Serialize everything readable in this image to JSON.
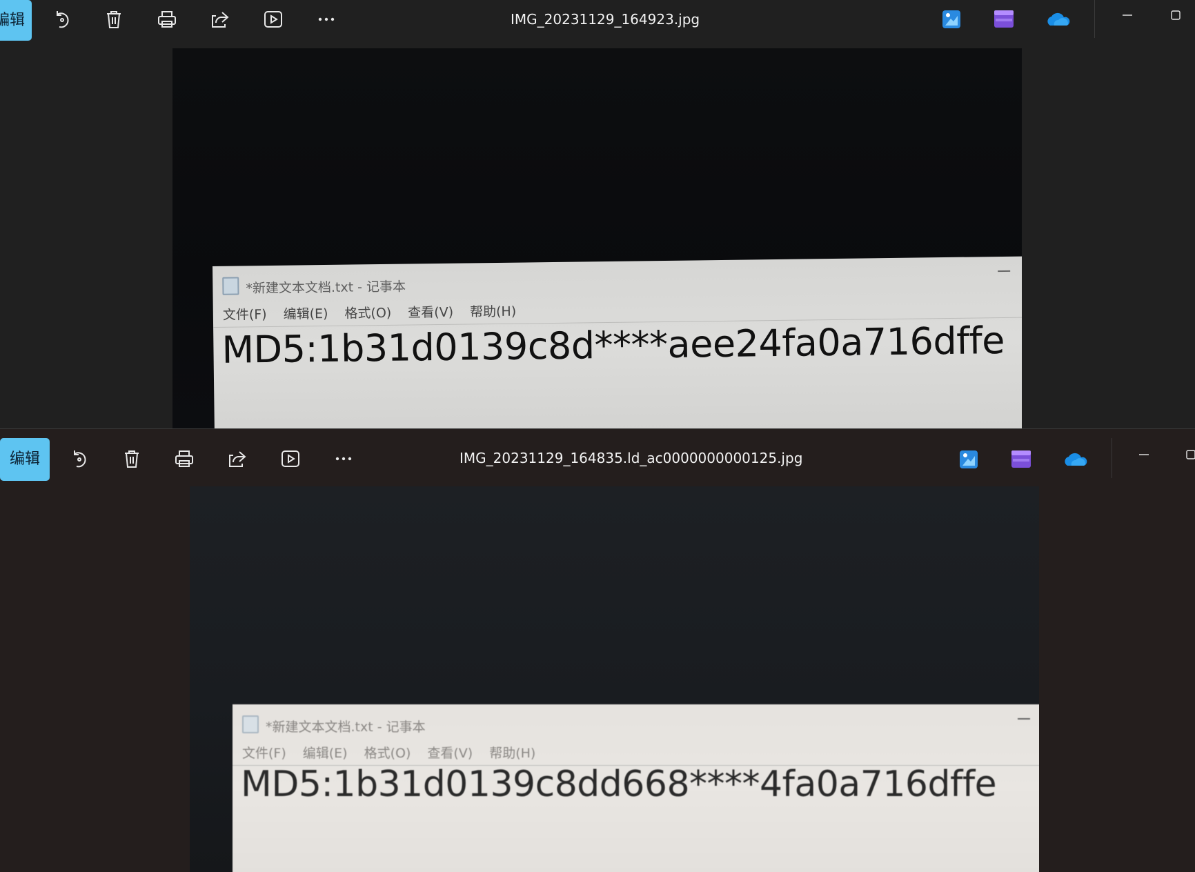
{
  "top_window": {
    "toolbar": {
      "edit_label": "编辑",
      "icons": [
        "rotate-icon",
        "delete-icon",
        "print-icon",
        "share-icon",
        "slideshow-icon",
        "more-icon"
      ],
      "title": "IMG_20231129_164923.jpg",
      "apps": [
        "photos-editor-icon",
        "clipchamp-icon",
        "onedrive-icon"
      ]
    },
    "notepad": {
      "title": "*新建文本文档.txt - 记事本",
      "menu": [
        "文件(F)",
        "编辑(E)",
        "格式(O)",
        "查看(V)",
        "帮助(H)"
      ],
      "content": "MD5:1b31d0139c8d****aee24fa0a716dffe"
    }
  },
  "bottom_window": {
    "toolbar": {
      "edit_label": "编辑",
      "icons": [
        "rotate-icon",
        "delete-icon",
        "print-icon",
        "share-icon",
        "slideshow-icon",
        "more-icon"
      ],
      "title": "IMG_20231129_164835.ld_ac0000000000125.jpg",
      "apps": [
        "photos-editor-icon",
        "clipchamp-icon",
        "onedrive-icon"
      ]
    },
    "notepad": {
      "title": "*新建文本文档.txt - 记事本",
      "menu": [
        "文件(F)",
        "编辑(E)",
        "格式(O)",
        "查看(V)",
        "帮助(H)"
      ],
      "content": "MD5:1b31d0139c8dd668****4fa0a716dffe"
    }
  },
  "colors": {
    "accent": "#5ec4f1",
    "toolbar_bg_top": "#202020",
    "toolbar_bg_bottom": "#241e1d"
  }
}
